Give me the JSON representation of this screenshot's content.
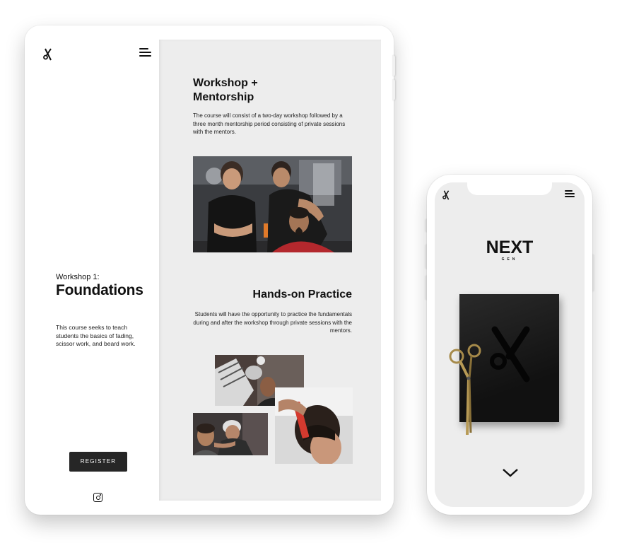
{
  "tablet": {
    "left_panel": {
      "logo": "scissors-logo-icon",
      "menu": "menu-icon",
      "eyebrow": "Workshop 1:",
      "title": "Foundations",
      "description": "This course seeks to teach students the basics of fading, scissor work, and beard work.",
      "register_label": "REGISTER",
      "social_icon": "instagram-icon"
    },
    "right_panel": {
      "section1_title": "Workshop + Mentorship",
      "section1_desc": "The course will consist of a two-day workshop followed by a three month mentorship period consisting of private sessions with the mentors.",
      "section2_title": "Hands-on Practice",
      "section2_desc": "Students will have the opportunity to practice the fundamentals during and after the workshop through private sessions with the mentors."
    }
  },
  "phone": {
    "logo": "scissors-logo-icon",
    "menu": "menu-icon",
    "brand": "NEXT",
    "brand_sub": "GEN",
    "scroll": "chevron-down-icon"
  },
  "colors": {
    "panel_bg": "#ededed",
    "button_bg": "#262626",
    "text": "#111111"
  }
}
